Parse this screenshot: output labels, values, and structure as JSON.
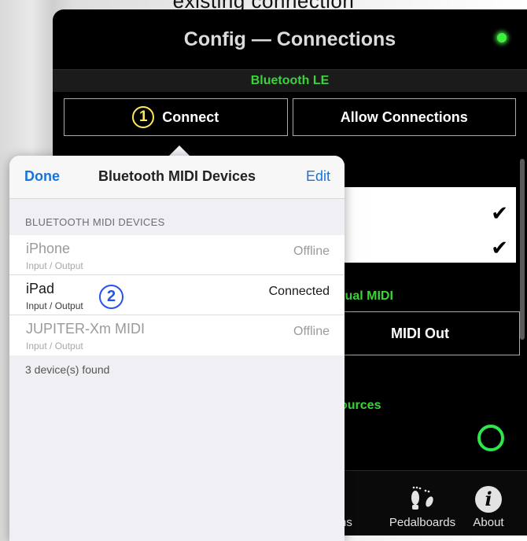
{
  "caption": "existing connection",
  "app": {
    "title": "Config — Connections",
    "section_ble": "Bluetooth LE",
    "connect_label": "Connect",
    "connect_step": "1",
    "allow_label": "Allow Connections",
    "checkmark": "✔",
    "virtual_midi_label": "rtual MIDI",
    "midi_out_label": "MIDI Out",
    "sources_label": "ources",
    "tabs": {
      "partial_label": "ns",
      "pedalboards_label": "Pedalboards",
      "about_label": "About",
      "about_icon_glyph": "i"
    },
    "colors": {
      "accent_green": "#39d439",
      "status_led": "#3df13d"
    }
  },
  "popover": {
    "done_label": "Done",
    "title": "Bluetooth MIDI Devices",
    "edit_label": "Edit",
    "section_header": "BLUETOOTH MIDI DEVICES",
    "devices": [
      {
        "name": "iPhone",
        "type": "Input / Output",
        "status": "Offline"
      },
      {
        "name": "iPad",
        "type": "Input / Output",
        "status": "Connected",
        "step": "2"
      },
      {
        "name": "JUPITER-Xm MIDI",
        "type": "Input / Output",
        "status": "Offline"
      }
    ],
    "footer": "3 device(s) found",
    "colors": {
      "link": "#1a73d9",
      "step_marker": "#2255ee"
    }
  }
}
